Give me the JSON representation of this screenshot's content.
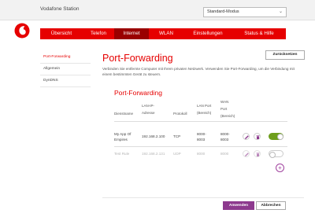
{
  "app": {
    "title": "Vodafone Station"
  },
  "mode_select": {
    "value": "Standard-Modus"
  },
  "nav": {
    "items": [
      "Übersicht",
      "Telefon",
      "Internet",
      "WLAN",
      "Einstellungen",
      "Status & Hilfe"
    ],
    "active": "Internet"
  },
  "sidebar": {
    "items": [
      "Port-Forwarding",
      "Allgemein",
      "DynDNS"
    ],
    "active": "Port-Forwarding"
  },
  "main": {
    "title": "Port-Forwarding",
    "reset_label": "Zurücksetzen",
    "description": "Verbinden Sie entfernte Computer mit Ihrem privaten Netzwerk. Verwenden Sie Port-Forwarding, um die Verbindung mit einem bestimmten Gerät zu steuern."
  },
  "table": {
    "title": "Port-Forwarding",
    "headers": {
      "service": "Dienstname",
      "lan_ip": [
        "LAN-IP-",
        "Adresse"
      ],
      "protocol": "Protokoll",
      "lan_port": [
        "LAN Port",
        "(Bereich)"
      ],
      "wan_port": [
        "WAN",
        "Port",
        "(Bereich)"
      ]
    },
    "rows": [
      {
        "service": [
          "My App Of",
          "Empires"
        ],
        "ip": "192.168.2.100",
        "protocol": "TCP",
        "lan_port": [
          "8000-",
          "8003"
        ],
        "wan_port": [
          "8000-",
          "8003"
        ],
        "enabled": true
      },
      {
        "service": [
          "Test Rule"
        ],
        "ip": "192.168.2.131",
        "protocol": "UDP",
        "lan_port": [
          "8000"
        ],
        "wan_port": [
          "8000"
        ],
        "enabled": false
      }
    ]
  },
  "footer": {
    "apply_label": "Anwenden",
    "cancel_label": "Abbrechen"
  },
  "colors": {
    "brand_red": "#e60000",
    "nav_active": "#9a0000",
    "accent_purple": "#8d3a8e",
    "toggle_on": "#6e9e1c"
  }
}
